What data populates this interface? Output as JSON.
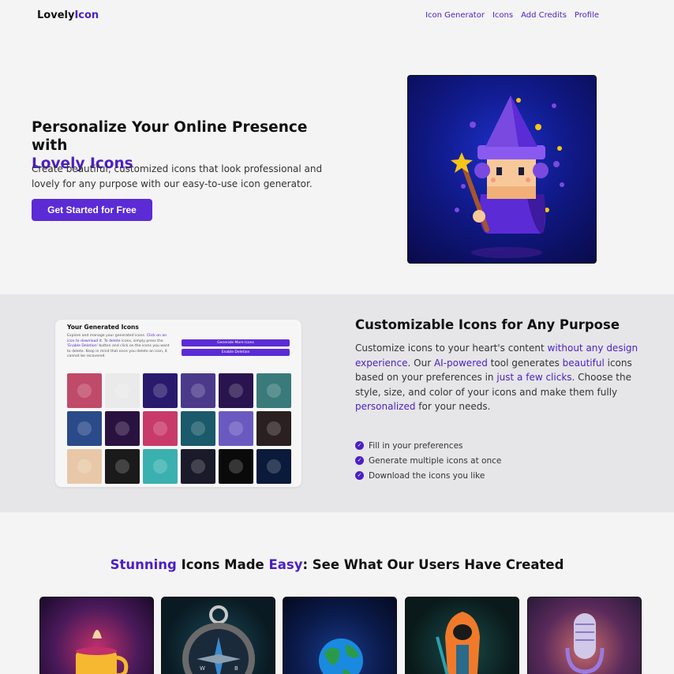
{
  "header": {
    "logo_part1": "Lovely",
    "logo_part2": "Icon",
    "nav": [
      "Icon Generator",
      "Icons",
      "Add Credits",
      "Profile"
    ]
  },
  "hero": {
    "title_line1": "Personalize Your Online Presence with",
    "title_line2": "Lovely Icons",
    "subtitle": "Create beautiful, customized icons that look professional and lovely for any purpose with our easy-to-use icon generator.",
    "cta": "Get Started for Free",
    "image": "wizard-icon"
  },
  "preview": {
    "title": "Your Generated Icons",
    "desc_1": "Explore and manage your generated icons.",
    "desc_link_1": "Click on an icon to download it.",
    "desc_2": "To",
    "desc_link_2": "delete",
    "desc_3": "icons, simply press the",
    "desc_link_3": "'Enable Deletion'",
    "desc_4": "button and click on the icons you want to delete. Keep in mind that once you delete an icon, it cannot be recovered.",
    "btn_generate": "Generate More Icons",
    "btn_delete": "Enable Deletion",
    "tiles": [
      "woman-silhouette-sunset",
      "gorilla-headphones",
      "planet-orb",
      "mountain-peaks",
      "neon-figure-arch",
      "warrior-sunset",
      "framed-gem",
      "pink-creature",
      "robot-face",
      "blue-wizard",
      "pixel-character",
      "red-panda",
      "coffee-cup",
      "hooded-figure",
      "island-trees",
      "crystal-ball",
      "dark-planet",
      "helicopter"
    ],
    "tile_colors": [
      "#c04a6a",
      "#eaeaea",
      "#2a1a6e",
      "#4b3a8a",
      "#2a1450",
      "#3a7a7a",
      "#2a4a8a",
      "#2a1240",
      "#c83a6a",
      "#1a5a6a",
      "#6a5ac0",
      "#2a2020",
      "#e8c8a8",
      "#1a1a1a",
      "#3ab0b0",
      "#1a1a2a",
      "#0a0a0a",
      "#0a1a3a"
    ]
  },
  "features": {
    "title": "Customizable Icons for Any Purpose",
    "t1": "Customize icons to your heart's content ",
    "l1": "without any design experience",
    "t2": ". Our ",
    "l2": "AI-powered",
    "t3": " tool generates ",
    "l3": "beautiful",
    "t4": " icons based on your preferences in ",
    "l4": "just a few clicks",
    "t5": ". Choose the style, size, and color of your icons and make them fully ",
    "l5": "personalized",
    "t6": " for your needs.",
    "checklist": [
      "Fill in your preferences",
      "Generate multiple icons at once",
      "Download the icons you like"
    ]
  },
  "gallery": {
    "title_a": "Stunning",
    "title_b": " Icons Made ",
    "title_c": "Easy",
    "title_d": ": See What Our Users Have Created",
    "cards": [
      "candle-mug",
      "compass",
      "globe",
      "hooded-warrior",
      "microphone"
    ]
  }
}
